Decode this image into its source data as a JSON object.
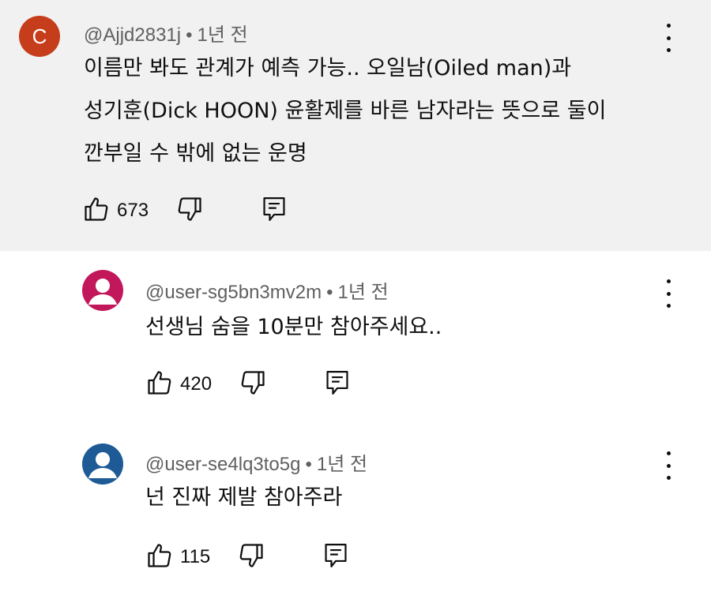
{
  "comments": [
    {
      "avatar_letter": "C",
      "avatar_color": "#c53d1b",
      "author": "@Ajjd2831j",
      "time": "1년 전",
      "lines": [
        "이름만 봐도 관계가 예측 가능.. 오일남(Oiled man)과",
        "성기훈(Dick HOON) 윤활제를 바른 남자라는 뜻으로 둘이",
        "깐부일 수 밖에 없는 운명"
      ],
      "likes": "673"
    },
    {
      "avatar_color": "#c2185b",
      "author": "@user-sg5bn3mv2m",
      "time": "1년 전",
      "lines": [
        "선생님 숨을 10분만 참아주세요.."
      ],
      "likes": "420"
    },
    {
      "avatar_color": "#1e5a96",
      "author": "@user-se4lq3to5g",
      "time": "1년 전",
      "lines": [
        "넌 진짜 제발 참아주라"
      ],
      "likes": "115"
    }
  ],
  "separator": "•",
  "icons": {
    "like": "thumb-up-icon",
    "dislike": "thumb-down-icon",
    "reply": "reply-icon",
    "more": "more-vert-icon"
  }
}
